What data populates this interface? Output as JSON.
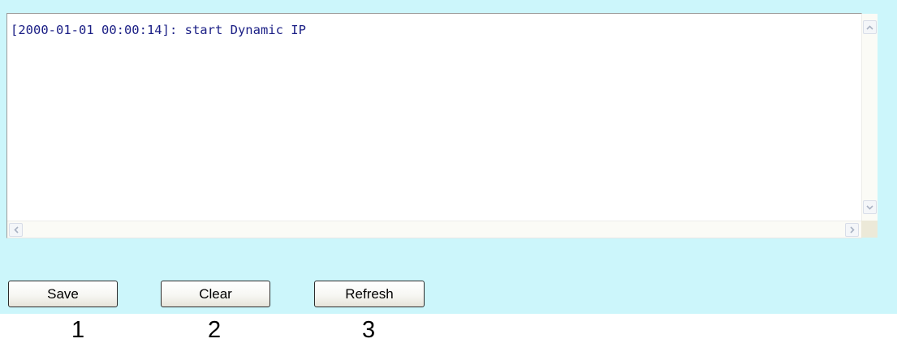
{
  "log": {
    "lines": [
      "[2000-01-01 00:00:14]: start Dynamic IP"
    ]
  },
  "scrollbars": {
    "up_arrow": "^",
    "down_arrow": "v",
    "left_arrow": "<",
    "right_arrow": ">"
  },
  "buttons": {
    "save_label": "Save",
    "clear_label": "Clear",
    "refresh_label": "Refresh"
  },
  "annotations": {
    "labels": [
      "1",
      "2",
      "3"
    ]
  },
  "colors": {
    "panel_background": "#ccf6fb",
    "log_text": "#1c2086",
    "log_background": "#ffffff"
  },
  "icons": {
    "scroll_up": "chevron-up-icon",
    "scroll_down": "chevron-down-icon",
    "scroll_left": "chevron-left-icon",
    "scroll_right": "chevron-right-icon"
  }
}
